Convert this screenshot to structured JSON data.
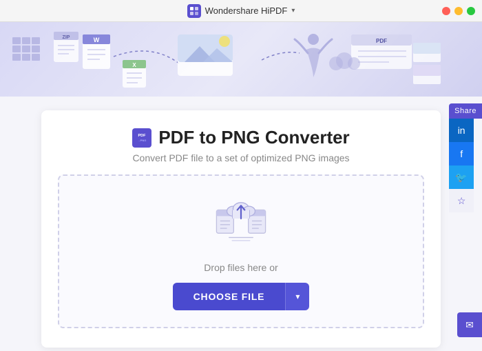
{
  "titleBar": {
    "appName": "Wondershare HiPDF",
    "chevron": "▾"
  },
  "card": {
    "title": "PDF to PNG Converter",
    "subtitle": "Convert PDF file to a set of optimized PNG images",
    "dropText": "Drop files here or",
    "chooseFileLabel": "CHOOSE FILE",
    "dropdownArrow": "▾"
  },
  "share": {
    "label": "Share",
    "linkedin": "in",
    "facebook": "f",
    "twitter": "🐦",
    "star": "☆",
    "email": "✉"
  }
}
